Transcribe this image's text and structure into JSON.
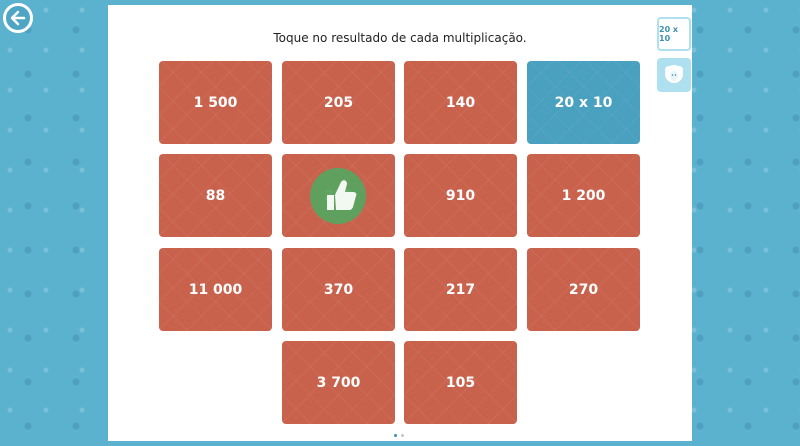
{
  "nav": {
    "back_icon": "arrow-left-icon"
  },
  "instruction": "Toque no resultado de cada multiplicação.",
  "tiles": [
    {
      "label": "1 500",
      "color": "#c9624d"
    },
    {
      "label": "205",
      "color": "#c9624d"
    },
    {
      "label": "140",
      "color": "#c9624d"
    },
    {
      "label": "20 x 10",
      "color": "#4aa0bf"
    },
    {
      "label": "88",
      "color": "#c9624d"
    },
    {
      "label": "200",
      "color": "#c9624d",
      "feedback_icon": "thumbs-up-icon"
    },
    {
      "label": "910",
      "color": "#c9624d"
    },
    {
      "label": "1 200",
      "color": "#c9624d"
    },
    {
      "label": "11 000",
      "color": "#c9624d"
    },
    {
      "label": "370",
      "color": "#c9624d"
    },
    {
      "label": "217",
      "color": "#c9624d"
    },
    {
      "label": "270",
      "color": "#c9624d"
    },
    {
      "label": "3 700",
      "color": "#c9624d"
    },
    {
      "label": "105",
      "color": "#c9624d"
    }
  ],
  "side_panel": {
    "current_question_label": "20 x 10",
    "helper_icon": "sheep-icon"
  },
  "pagination": {
    "pages": 2,
    "current": 1
  },
  "colors": {
    "background": "#5bb2cf",
    "tile": "#c9624d",
    "active_tile": "#4aa0bf",
    "correct": "#5aa35f"
  }
}
